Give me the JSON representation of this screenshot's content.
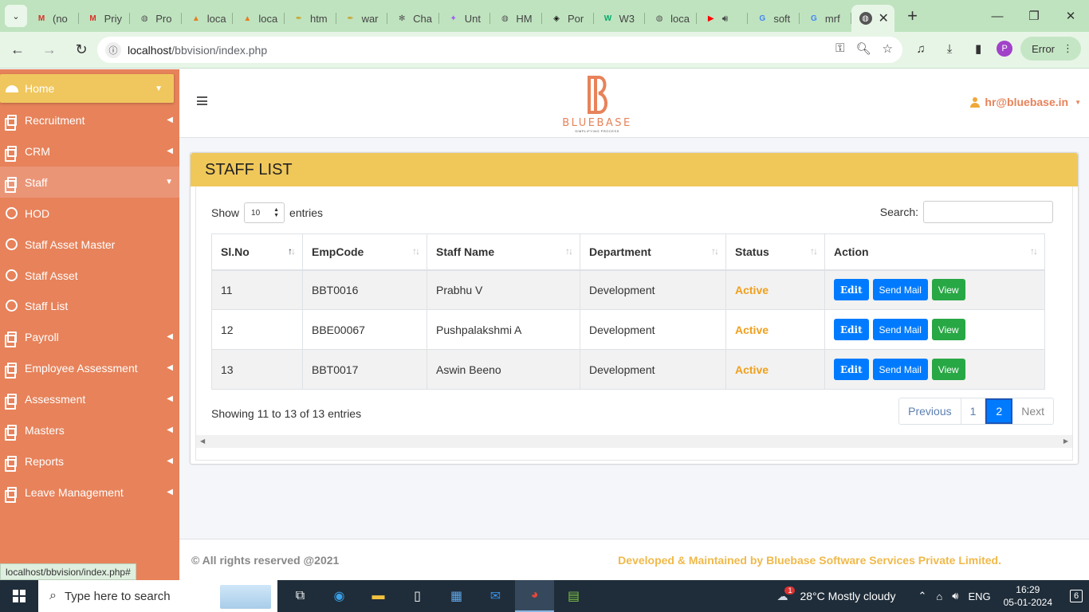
{
  "browser": {
    "tabs": [
      {
        "label": "(no",
        "favicon": "gmail-icon",
        "color": "#d93025"
      },
      {
        "label": "Priy",
        "favicon": "gmail-icon",
        "color": "#d93025"
      },
      {
        "label": "Pro",
        "favicon": "globe-icon",
        "color": "#555555"
      },
      {
        "label": "loca",
        "favicon": "pma-icon",
        "color": "#e67e22"
      },
      {
        "label": "loca",
        "favicon": "pma-icon",
        "color": "#e67e22"
      },
      {
        "label": "htm",
        "favicon": "feather-icon",
        "color": "#c9a227"
      },
      {
        "label": "war",
        "favicon": "feather-icon",
        "color": "#c9a227"
      },
      {
        "label": "Cha",
        "favicon": "chatgpt-icon",
        "color": "#555555"
      },
      {
        "label": "Unt",
        "favicon": "figma-icon",
        "color": "#a259ff"
      },
      {
        "label": "HM",
        "favicon": "globe-icon",
        "color": "#555555"
      },
      {
        "label": "Por",
        "favicon": "codepen-icon",
        "color": "#111111"
      },
      {
        "label": "W3",
        "favicon": "w3-icon",
        "color": "#04aa6d"
      },
      {
        "label": "loca",
        "favicon": "globe-icon",
        "color": "#555555"
      },
      {
        "label": "",
        "favicon": "youtube-icon",
        "color": "#ff0000"
      },
      {
        "label": "soft",
        "favicon": "google-icon",
        "color": "#4285f4"
      },
      {
        "label": "mrf",
        "favicon": "google-icon",
        "color": "#4285f4"
      }
    ],
    "active_tab_close": "✕",
    "new_tab": "+",
    "url_host": "localhost",
    "url_path": "/bbvision/index.php",
    "profile_initial": "P",
    "error_label": "Error",
    "status_url": "localhost/bbvision/index.php#"
  },
  "sidebar": {
    "items": [
      {
        "label": "Home",
        "icon": "dashboard-icon"
      },
      {
        "label": "Recruitment",
        "icon": "copy-icon"
      },
      {
        "label": "CRM",
        "icon": "copy-icon"
      },
      {
        "label": "Staff",
        "icon": "copy-icon"
      },
      {
        "label": "HOD",
        "icon": "circle-icon"
      },
      {
        "label": "Staff Asset Master",
        "icon": "circle-icon"
      },
      {
        "label": "Staff Asset",
        "icon": "circle-icon"
      },
      {
        "label": "Staff List",
        "icon": "circle-icon"
      },
      {
        "label": "Payroll",
        "icon": "copy-icon"
      },
      {
        "label": "Employee Assessment",
        "icon": "copy-icon"
      },
      {
        "label": "Assessment",
        "icon": "copy-icon"
      },
      {
        "label": "Masters",
        "icon": "copy-icon"
      },
      {
        "label": "Reports",
        "icon": "copy-icon"
      },
      {
        "label": "Leave Management",
        "icon": "copy-icon"
      }
    ]
  },
  "header": {
    "logo_text": "BLUEBASE",
    "logo_tagline": "SIMPLIFYING PROCESS",
    "user_email": "hr@bluebase.in"
  },
  "card": {
    "title": "STAFF LIST",
    "show_label": "Show",
    "entries_label": "entries",
    "page_length": "10",
    "search_label": "Search:",
    "search_value": "",
    "columns": [
      "Sl.No",
      "EmpCode",
      "Staff Name",
      "Department",
      "Status",
      "Action"
    ],
    "rows": [
      {
        "slno": "11",
        "empcode": "BBT0016",
        "name": "Prabhu V",
        "department": "Development",
        "status": "Active"
      },
      {
        "slno": "12",
        "empcode": "BBE00067",
        "name": "Pushpalakshmi A",
        "department": "Development",
        "status": "Active"
      },
      {
        "slno": "13",
        "empcode": "BBT0017",
        "name": "Aswin Beeno",
        "department": "Development",
        "status": "Active"
      }
    ],
    "actions": {
      "edit": "Edit",
      "send_mail": "Send Mail",
      "view": "View"
    },
    "info": "Showing 11 to 13 of 13 entries",
    "pagination": {
      "previous": "Previous",
      "pages": [
        "1",
        "2"
      ],
      "current": "2",
      "next": "Next"
    }
  },
  "footer": {
    "copyright": "© All rights reserved @2021",
    "developer": "Developed & Maintained by Bluebase Software Services Private Limited."
  },
  "taskbar": {
    "search_placeholder": "Type here to search",
    "weather": "28°C  Mostly cloudy",
    "language": "ENG",
    "time": "16:29",
    "date": "05-01-2024",
    "notification_count": "6",
    "weather_badge": "1"
  },
  "colors": {
    "sidebar": "#e7825a",
    "home_active": "#f0c75e",
    "card_header": "#f0c85a",
    "status_active": "#f0a01e",
    "primary": "#007bff",
    "success": "#28a745"
  }
}
